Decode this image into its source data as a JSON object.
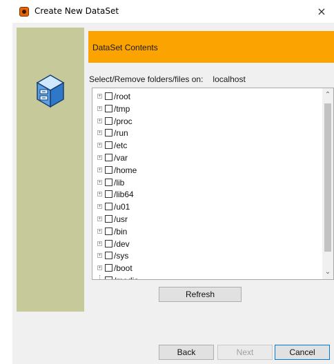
{
  "window": {
    "title": "Create New DataSet",
    "close_glyph": "×"
  },
  "header": {
    "title": "DataSet Contents",
    "accent_color": "#fba300"
  },
  "side_panel": {
    "color": "#c6c99a",
    "icon": "database-cabinet-icon"
  },
  "selection": {
    "label": "Select/Remove folders/files on:",
    "host": "localhost"
  },
  "tree": {
    "items": [
      {
        "label": "/root"
      },
      {
        "label": "/tmp"
      },
      {
        "label": "/proc"
      },
      {
        "label": "/run"
      },
      {
        "label": "/etc"
      },
      {
        "label": "/var"
      },
      {
        "label": "/home"
      },
      {
        "label": "/lib"
      },
      {
        "label": "/lib64"
      },
      {
        "label": "/u01"
      },
      {
        "label": "/usr"
      },
      {
        "label": "/bin"
      },
      {
        "label": "/dev"
      },
      {
        "label": "/sys"
      },
      {
        "label": "/boot"
      },
      {
        "label": "/media"
      }
    ]
  },
  "buttons": {
    "refresh": "Refresh",
    "back": "Back",
    "next": "Next",
    "cancel": "Cancel"
  }
}
